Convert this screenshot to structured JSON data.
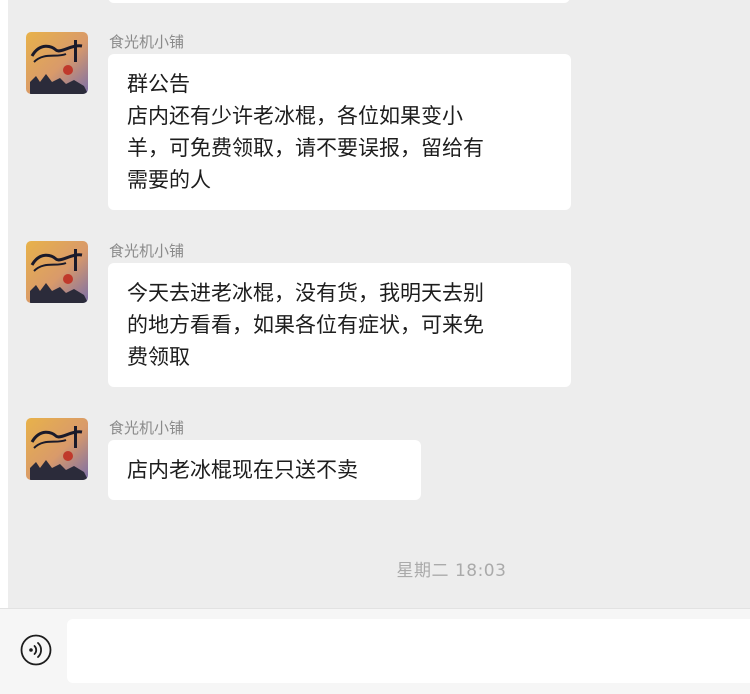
{
  "messages": [
    {
      "sender": "食光机小铺",
      "lines": [
        "群公告",
        "店内还有少许老冰棍，各位如果变小",
        "羊，可免费领取，请不要误报，留给有",
        "需要的人"
      ]
    },
    {
      "sender": "食光机小铺",
      "lines": [
        "今天去进老冰棍，没有货，我明天去别",
        "的地方看看，如果各位有症状，可来免",
        "费领取"
      ]
    },
    {
      "sender": "食光机小铺",
      "lines": [
        "店内老冰棍现在只送不卖"
      ]
    }
  ],
  "timestamp": "星期二 18:03",
  "input": {
    "value": "",
    "placeholder": ""
  },
  "icons": {
    "avatar": "shop-avatar-image",
    "voice": "voice-input-icon"
  }
}
